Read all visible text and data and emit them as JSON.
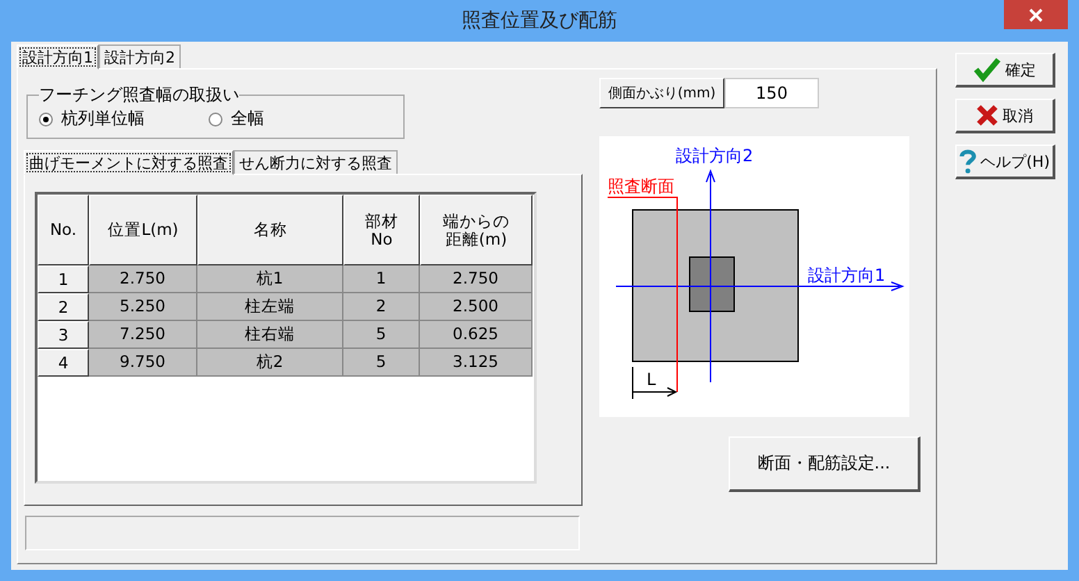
{
  "window": {
    "title": "照査位置及び配筋"
  },
  "tabs": [
    {
      "label": "設計方向1",
      "selected": true
    },
    {
      "label": "設計方向2",
      "selected": false
    }
  ],
  "width_group": {
    "title": "フーチング照査幅の取扱い",
    "options": [
      {
        "label": "杭列単位幅",
        "selected": true
      },
      {
        "label": "全幅",
        "selected": false
      }
    ]
  },
  "check_tabs": [
    {
      "label": "曲げモーメントに対する照査",
      "selected": true
    },
    {
      "label": "せん断力に対する照査",
      "selected": false
    }
  ],
  "table": {
    "columns": [
      "No.",
      "位置L(m)",
      "名称",
      "部材 No",
      "端からの距離(m)"
    ],
    "rows": [
      [
        "1",
        "2.750",
        "杭1",
        "1",
        "2.750"
      ],
      [
        "2",
        "5.250",
        "柱左端",
        "2",
        "2.500"
      ],
      [
        "3",
        "7.250",
        "柱右端",
        "5",
        "0.625"
      ],
      [
        "4",
        "9.750",
        "杭2",
        "5",
        "3.125"
      ]
    ]
  },
  "side_cover": {
    "label": "側面かぶり(mm)",
    "value": "150"
  },
  "diagram": {
    "axis_2": "設計方向2",
    "axis_1": "設計方向1",
    "section": "照査断面",
    "dimension": "L"
  },
  "section_button": "断面・配筋設定...",
  "buttons": [
    {
      "kind": "ok",
      "label": "確定"
    },
    {
      "kind": "cancel",
      "label": "取消"
    },
    {
      "kind": "help",
      "label": "ヘルプ(H)"
    }
  ]
}
